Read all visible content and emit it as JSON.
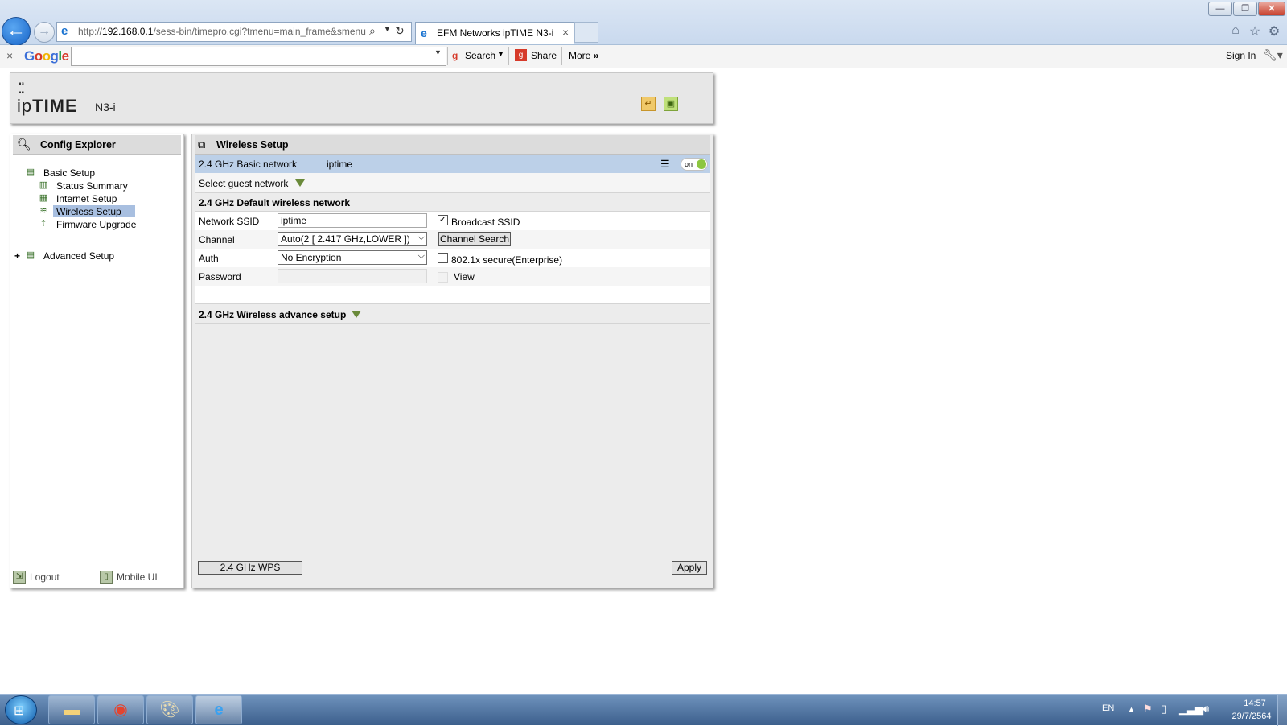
{
  "browser": {
    "address_url_prefix": "http://",
    "address_host": "192.168.0.1",
    "address_path": "/sess-bin/timepro.cgi?tmenu=main_frame&smenu",
    "tab_title": "EFM Networks ipTIME N3-i",
    "tab_close": "×",
    "window_controls": [
      "—",
      "❐",
      "✕"
    ]
  },
  "google_toolbar": {
    "close": "×",
    "logo_letters": [
      "G",
      "o",
      "o",
      "g",
      "l",
      "e"
    ],
    "logo_colors": [
      "#3c6fd8",
      "#d63a2a",
      "#f2b400",
      "#3c6fd8",
      "#1a9c3e",
      "#d63a2a"
    ],
    "search_value": "",
    "search_label": "Search",
    "share_label": "Share",
    "more_label": "More",
    "signin_label": "Sign In"
  },
  "router": {
    "logo_ip": "ip",
    "logo_time": "TIME",
    "model": "N3-i"
  },
  "config_explorer": {
    "title": "Config Explorer",
    "basic_setup": "Basic Setup",
    "items": [
      {
        "label": "Status Summary"
      },
      {
        "label": "Internet Setup"
      },
      {
        "label": "Wireless Setup"
      },
      {
        "label": "Firmware Upgrade"
      }
    ],
    "advanced_expander": "+",
    "advanced_setup": "Advanced Setup",
    "logout": "Logout",
    "mobile_ui": "Mobile UI"
  },
  "wireless": {
    "title": "Wireless Setup",
    "basic_network_label": "2.4 GHz Basic network",
    "basic_network_ssid": "iptime",
    "toggle_label": "on",
    "guest_network_label": "Select guest network",
    "section_title": "2.4 GHz Default wireless network",
    "fields": {
      "ssid_label": "Network SSID",
      "ssid_value": "iptime",
      "broadcast_ssid_label": "Broadcast SSID",
      "broadcast_ssid_checked": true,
      "channel_label": "Channel",
      "channel_value": "Auto(2 [ 2.417 GHz,LOWER ])",
      "channel_search_label": "Channel Search",
      "auth_label": "Auth",
      "auth_value": "No Encryption",
      "enterprise_label": "802.1x secure(Enterprise)",
      "enterprise_checked": false,
      "password_label": "Password",
      "password_value": "",
      "view_label": "View"
    },
    "advance_setup_label": "2.4 GHz Wireless advance setup",
    "wps_button": "2.4 GHz WPS",
    "apply_button": "Apply"
  },
  "taskbar": {
    "language": "EN",
    "time": "14:57",
    "date": "29/7/2564"
  },
  "colors": {
    "selected_tree_item": "#a8bfe0",
    "basic_network_row": "#bcd0e8",
    "toggle_on": "#8cc63f",
    "dropdown_triangle": "#6a8a3a"
  }
}
